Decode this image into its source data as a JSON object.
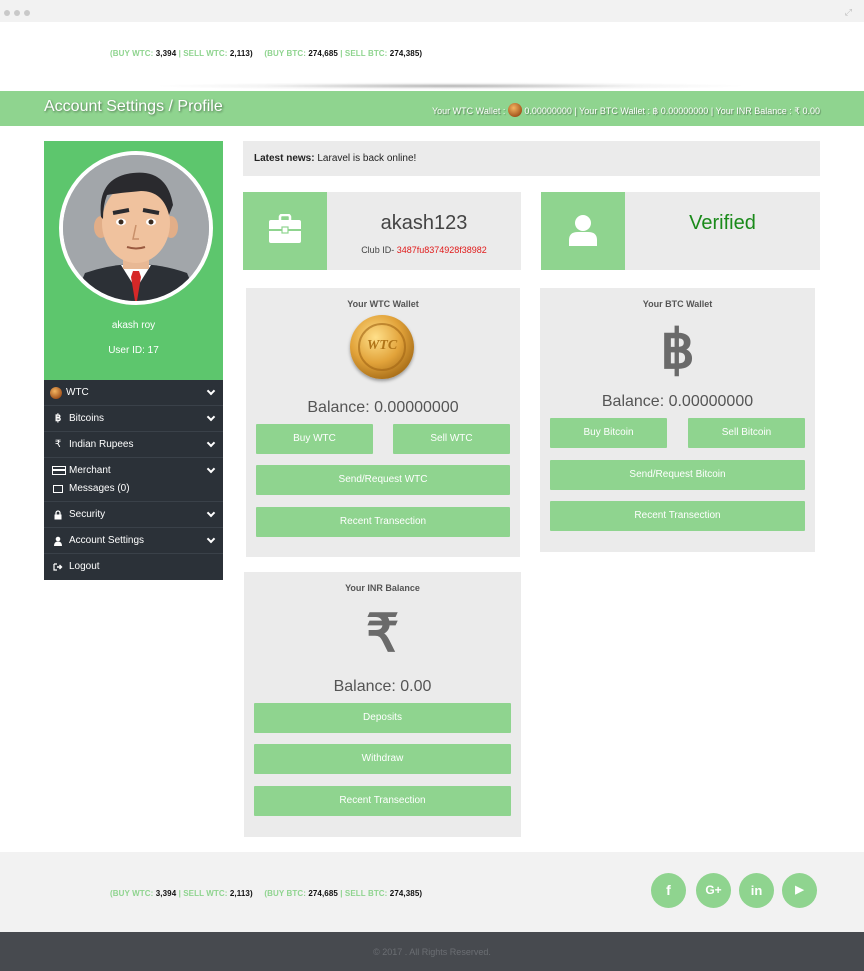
{
  "ticker": {
    "wtc_open": "(BUY WTC: ",
    "buy_wtc": "3,394",
    "sell_wtc_label": " | SELL WTC: ",
    "sell_wtc": "2,113",
    "wtc_close": ")",
    "btc_open": "(BUY BTC: ",
    "buy_btc": "274,685",
    "sell_btc_label": " | SELL BTC: ",
    "sell_btc": "274,385",
    "btc_close": ")"
  },
  "header": {
    "title": "Account Settings / Profile",
    "wtc_wallet_label": "Your WTC Wallet :",
    "wtc_wallet_value": "0.00000000",
    "btc_wallet_label": "| Your BTC Wallet :",
    "btc_symbol": "฿",
    "btc_wallet_value": "0.00000000",
    "inr_label": "| Your INR Balance :",
    "inr_value": "₹ 0.00"
  },
  "profile": {
    "name": "akash roy",
    "user_id": "User ID: 17"
  },
  "menu": [
    {
      "label": "WTC",
      "icon": "wtc-coin-icon"
    },
    {
      "label": "Bitcoins",
      "icon": "bitcoin-icon"
    },
    {
      "label": "Indian Rupees",
      "icon": "rupee-icon"
    },
    {
      "label": "Merchant",
      "icon": "card-icon",
      "sub": "Messages (0)"
    },
    {
      "label": "Security",
      "icon": "lock-icon"
    },
    {
      "label": "Account Settings",
      "icon": "user-icon"
    },
    {
      "label": "Logout",
      "icon": "logout-icon"
    }
  ],
  "news": {
    "label": "Latest news:",
    "text": "Laravel is back online!"
  },
  "user_card": {
    "username": "akash123",
    "club_label": "Club ID-",
    "club_id": "3487fu8374928f38982"
  },
  "verified_card": {
    "status": "Verified"
  },
  "wtc_wallet": {
    "title": "Your WTC Wallet",
    "coin_text": "WTC",
    "balance": "Balance: 0.00000000",
    "buy": "Buy WTC",
    "sell": "Sell WTC",
    "send": "Send/Request WTC",
    "recent": "Recent Transection"
  },
  "btc_wallet": {
    "title": "Your BTC Wallet",
    "glyph": "฿",
    "balance": "Balance: 0.00000000",
    "buy": "Buy Bitcoin",
    "sell": "Sell Bitcoin",
    "send": "Send/Request Bitcoin",
    "recent": "Recent Transection"
  },
  "inr_wallet": {
    "title": "Your INR Balance",
    "glyph": "₹",
    "balance": "Balance: 0.00",
    "deposits": "Deposits",
    "withdraw": "Withdraw",
    "recent": "Recent Transection"
  },
  "social": {
    "facebook": "f",
    "google": "G+",
    "linkedin": "in",
    "youtube": "▶"
  },
  "footer": {
    "copyright": "© 2017 . All Rights Reserved."
  },
  "colors": {
    "accent": "#8fd48f",
    "sidebar_green": "#5dc66d",
    "sidebar_dark": "#2b3138",
    "footer_dark": "#474a4f",
    "verified": "#1a8a1a",
    "club_id": "#e01b1b"
  }
}
